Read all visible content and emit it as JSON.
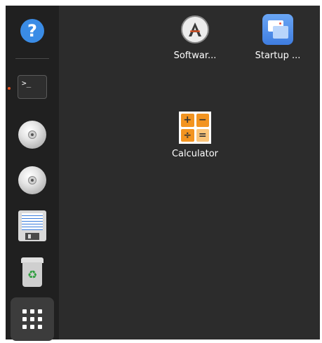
{
  "dock": {
    "items": [
      {
        "name": "help",
        "glyph": "?"
      },
      {
        "name": "terminal",
        "glyph": ">_"
      },
      {
        "name": "disc-1"
      },
      {
        "name": "disc-2"
      },
      {
        "name": "floppy"
      },
      {
        "name": "trash",
        "glyph": "♻"
      },
      {
        "name": "show-apps"
      }
    ],
    "running_indicator_color": "#e95420"
  },
  "desktop": {
    "icons": [
      {
        "label": "Softwar...",
        "icon": "software-icon"
      },
      {
        "label": "Startup ...",
        "icon": "startup-icon"
      },
      {
        "label": "Calculator",
        "icon": "calculator-icon",
        "keys": [
          "+",
          "−",
          "÷",
          "="
        ]
      }
    ]
  },
  "colors": {
    "dock_bg": "#202020",
    "desktop_bg": "#2c2c2c",
    "accent": "#e95420"
  }
}
